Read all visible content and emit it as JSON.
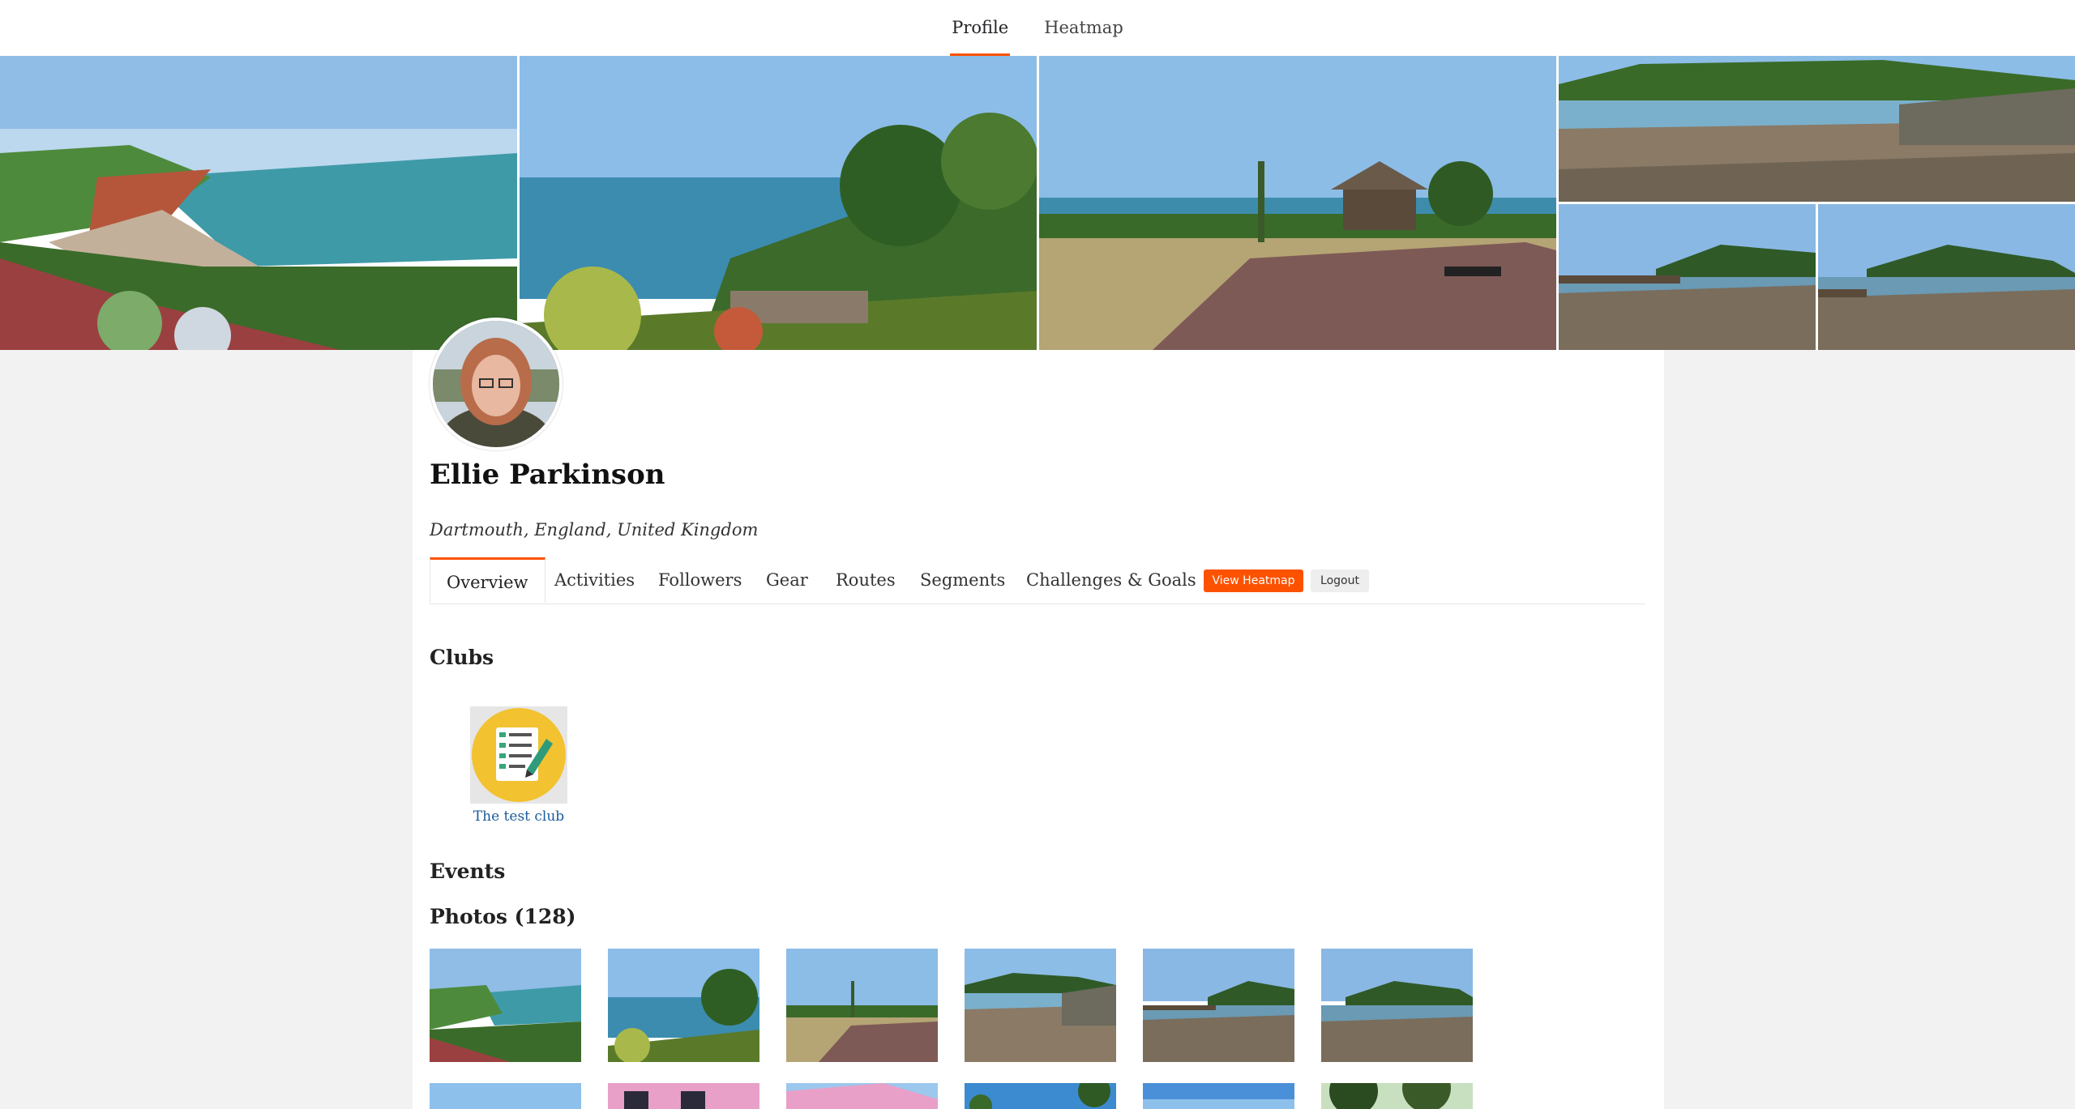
{
  "topnav": {
    "tabs": [
      {
        "label": "Profile",
        "active": true
      },
      {
        "label": "Heatmap",
        "active": false
      }
    ]
  },
  "banner": {
    "images": [
      "coast-cliff-view",
      "palm-garden-sea",
      "park-gazebo-sea",
      "harbour-low-tide",
      "jetty-low-tide",
      "estuary-low-tide"
    ]
  },
  "athlete": {
    "name": "Ellie Parkinson",
    "location": "Dartmouth, England, United Kingdom"
  },
  "profile_tabs": [
    "Overview",
    "Activities",
    "Followers",
    "Gear",
    "Routes",
    "Segments",
    "Challenges & Goals"
  ],
  "buttons": {
    "view_heatmap": "View Heatmap",
    "logout": "Logout"
  },
  "sections": {
    "clubs": "Clubs",
    "events": "Events",
    "photos": "Photos (128)"
  },
  "clubs": [
    {
      "name": "The test club",
      "icon": "checklist-icon"
    }
  ],
  "colors": {
    "accent": "#fc5200",
    "link": "#1a5a9a"
  }
}
